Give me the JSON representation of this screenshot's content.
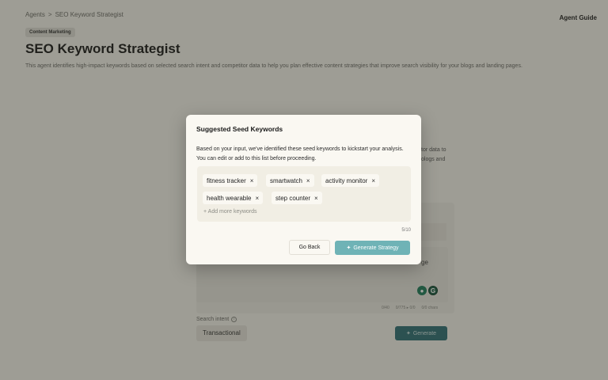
{
  "breadcrumb": {
    "root": "Agents",
    "separator": ">",
    "current": "SEO Keyword Strategist"
  },
  "header": {
    "guide_link": "Agent Guide"
  },
  "agent": {
    "category": "Content Marketing",
    "title": "SEO Keyword Strategist",
    "description": "This agent identifies high-impact keywords based on selected search intent and competitor data to help you plan effective content strategies that improve search visibility for your blogs and landing pages."
  },
  "background_form": {
    "side_text_line1": "tor data to",
    "side_text_line2": "ologs and",
    "textarea_tail": "ge",
    "counter_words": "0/40",
    "counter_chars": "0/775 ▸ 0/0",
    "counter_extra": "0/0 chars",
    "intent_label": "Search intent",
    "intent_value": "Transactional",
    "generate_label": "Generate"
  },
  "modal": {
    "title": "Suggested Seed Keywords",
    "description": "Based on your input, we've identified these seed keywords to kickstart your analysis. You can edit or add to this list before proceeding.",
    "keywords": [
      {
        "label": "fitness tracker"
      },
      {
        "label": "smartwatch"
      },
      {
        "label": "activity monitor"
      },
      {
        "label": "health wearable"
      },
      {
        "label": "step counter"
      }
    ],
    "remove_glyph": "×",
    "add_more_placeholder": "+ Add more keywords",
    "keyword_count": "5/10",
    "back_label": "Go Back",
    "generate_label": "Generate Strategy"
  },
  "icons": {
    "sparkle": "sparkle-icon",
    "info": "info-icon",
    "grammar_a": "grammarly-icon",
    "grammar_b": "g-assistant-icon"
  },
  "colors": {
    "accent_teal": "#6fb3b6",
    "dark_teal": "#2f6f75",
    "modal_bg": "#faf8f2"
  }
}
